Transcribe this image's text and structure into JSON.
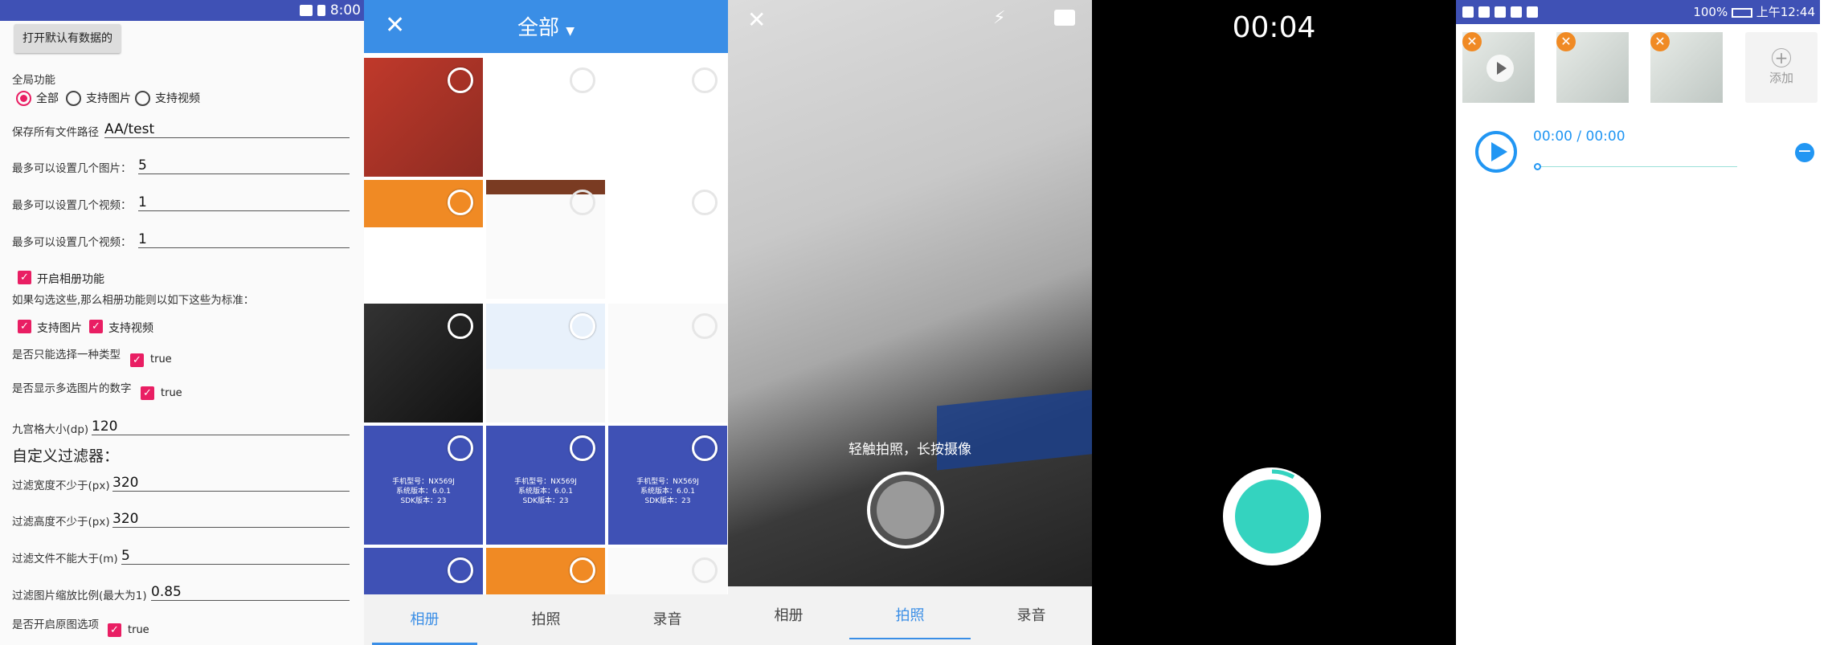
{
  "panel1": {
    "status_time": "8:00",
    "open_default_button": "打开默认有数据的",
    "global_label": "全局功能",
    "radio_all": "全部",
    "radio_image": "支持图片",
    "radio_video": "支持视频",
    "save_path_label": "保存所有文件路径",
    "save_path_value": "AA/test",
    "max_images_label": "最多可以设置几个图片：",
    "max_images_value": "5",
    "max_videos_label": "最多可以设置几个视频：",
    "max_videos_value": "1",
    "max_videos2_label": "最多可以设置几个视频：",
    "max_videos2_value": "1",
    "enable_album": "开启相册功能",
    "album_note": "如果勾选这些,那么相册功能则以如下这些为标准：",
    "cb_image": "支持图片",
    "cb_video": "支持视频",
    "single_type_label": "是否只能选择一种类型",
    "single_type_value": "true",
    "show_count_label": "是否显示多选图片的数字",
    "show_count_value": "true",
    "grid_size_label": "九宫格大小(dp)",
    "grid_size_value": "120",
    "custom_filter": "自定义过滤器：",
    "width_label": "过滤宽度不少于(px)",
    "width_value": "320",
    "height_label": "过滤高度不少于(px)",
    "height_value": "320",
    "size_label": "过滤文件不能大于(m)",
    "size_value": "5",
    "ratio_label": "过滤图片缩放比例(最大为1)",
    "ratio_value": "0.85",
    "original_label": "是否开启原图选项",
    "original_value": "true"
  },
  "panel2": {
    "title": "全部",
    "blue_tile_text": [
      "手机型号：NX569J",
      "系统版本：6.0.1",
      "SDK版本：23"
    ],
    "tabs": [
      "相册",
      "拍照",
      "录音"
    ],
    "active_tab": 0
  },
  "panel3": {
    "hint": "轻触拍照，长按摄像",
    "tabs": [
      "相册",
      "拍照",
      "录音"
    ],
    "active_tab": 1
  },
  "panel4": {
    "timer": "00:04",
    "progress": 0.08
  },
  "panel5": {
    "status_battery": "100%",
    "status_time": "上午12:44",
    "add_label": "添加",
    "time": "00:00 / 00:00"
  },
  "colors": {
    "accent_pink": "#e91e63",
    "accent_blue": "#3a8ee6",
    "record_teal": "#34d3bf"
  }
}
